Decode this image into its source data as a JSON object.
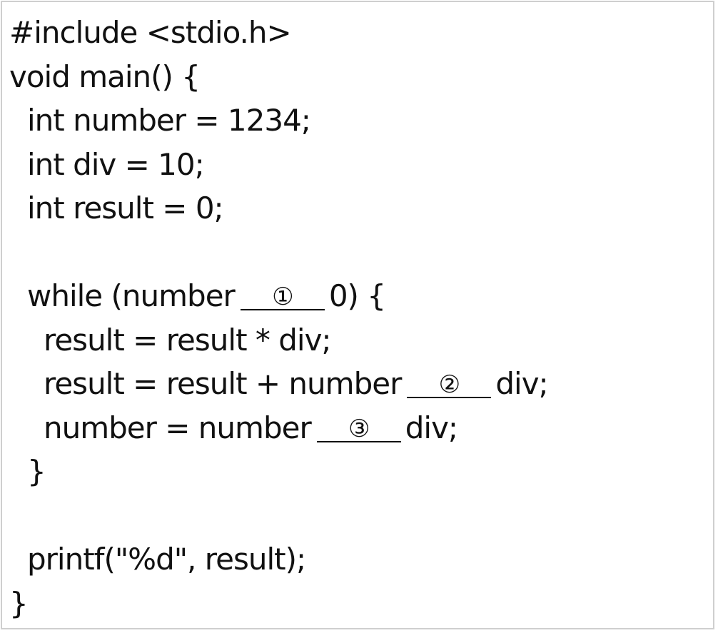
{
  "code": {
    "line1": "#include <stdio.h>",
    "line2": "void main() {",
    "line3": "int number = 1234;",
    "line4": "int div = 10;",
    "line5": "int result = 0;",
    "line7_before": "while (number",
    "blank1": "①",
    "line7_after": "0) {",
    "line8": "result = result * div;",
    "line9_before": "result = result + number",
    "blank2": "②",
    "line9_after": "div;",
    "line10_before": "number = number",
    "blank3": "③",
    "line10_after": "div;",
    "line11": "}",
    "line13": "printf(\"%d\", result);",
    "line14": "}"
  }
}
